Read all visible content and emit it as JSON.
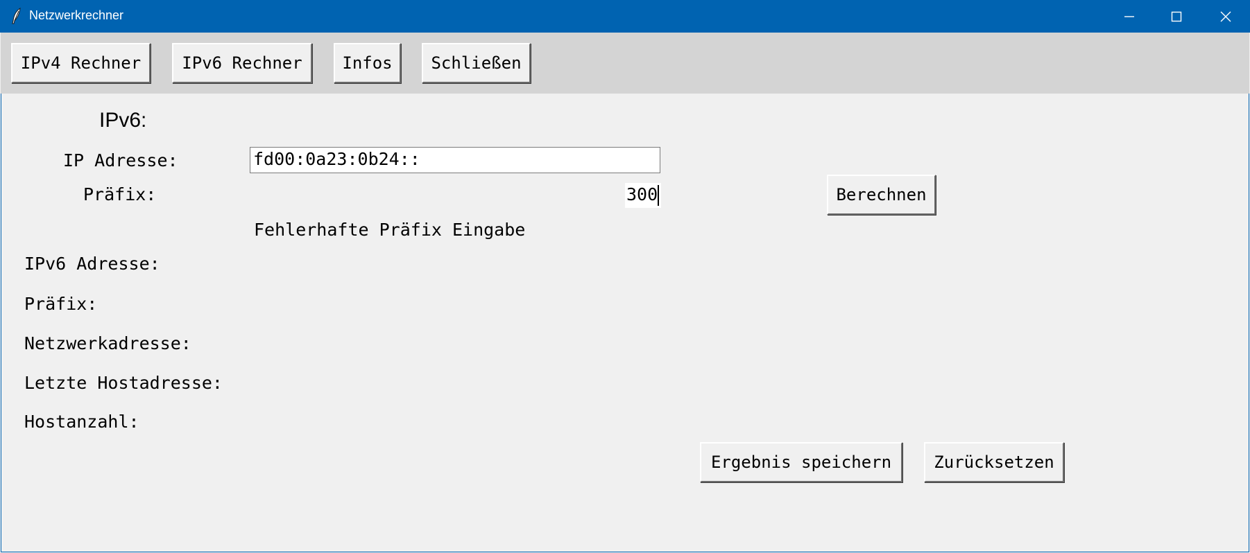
{
  "window": {
    "title": "Netzwerkrechner",
    "title_icon": "feather-icon",
    "controls": [
      "minimize-icon",
      "maximize-icon",
      "close-icon"
    ]
  },
  "toolbar": {
    "ipv4_label": "IPv4 Rechner",
    "ipv6_label": "IPv6 Rechner",
    "info_label": "Infos",
    "close_label": "Schließen"
  },
  "form": {
    "heading": "IPv6:",
    "ip_label": "IP Adresse:",
    "ip_value": "fd00:0a23:0b24::",
    "prefix_label": "Präfix:",
    "prefix_value": "300",
    "calc_label": "Berechnen",
    "error_message": "Fehlerhafte Präfix Eingabe"
  },
  "results": {
    "ipv6_address_label": "IPv6 Adresse:",
    "prefix_label": "Präfix:",
    "network_address_label": "Netzwerkadresse:",
    "last_host_label": "Letzte Hostadresse:",
    "host_count_label": "Hostanzahl:"
  },
  "actions": {
    "save_label": "Ergebnis speichern",
    "reset_label": "Zurücksetzen"
  },
  "colors": {
    "titlebar": "#0063b1",
    "toolbar": "#d4d4d4",
    "background": "#f0f0f0"
  }
}
